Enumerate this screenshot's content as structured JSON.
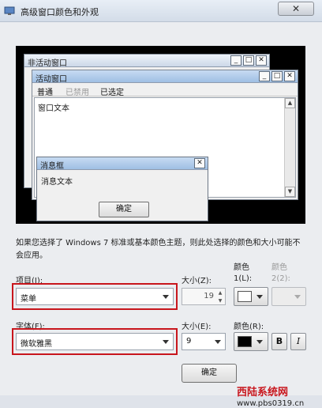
{
  "window": {
    "title": "高级窗口颜色和外观",
    "close": "✕"
  },
  "preview": {
    "inactive_title": "非活动窗口",
    "active_title": "活动窗口",
    "menu": {
      "normal": "普通",
      "disabled": "已禁用",
      "selected": "已选定"
    },
    "window_text": "窗口文本",
    "msgbox_title": "消息框",
    "msgbox_text": "消息文本",
    "ok": "确定"
  },
  "note": "如果您选择了 Windows 7 标准或基本颜色主题，则此处选择的颜色和大小可能不会应用。",
  "item": {
    "label": "项目(I):",
    "value": "菜单"
  },
  "size1": {
    "label": "大小(Z):",
    "value": "19"
  },
  "color1": {
    "label": "颜色 1(L):",
    "swatch": "#ffffff"
  },
  "color2": {
    "label": "颜色 2(2):"
  },
  "font": {
    "label": "字体(F):",
    "value": "微软雅黑"
  },
  "size2": {
    "label": "大小(E):",
    "value": "9"
  },
  "fontcolor": {
    "label": "颜色(R):",
    "swatch": "#000000"
  },
  "bold": "B",
  "italic": "I",
  "ok_button": "确定",
  "watermark": {
    "brand": "西陆系统网",
    "url": "www.pbs0319.cn"
  }
}
